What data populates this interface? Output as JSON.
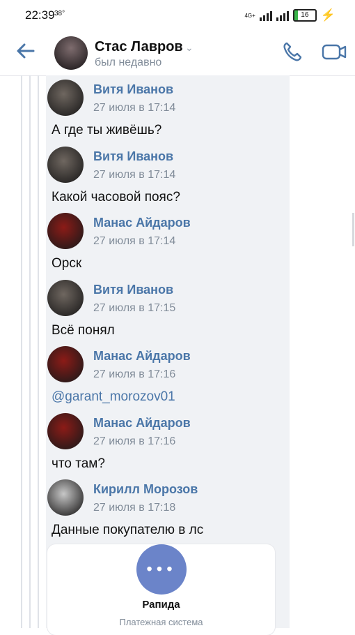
{
  "status_bar": {
    "time": "22:39",
    "temp": "38°",
    "network": "4G+",
    "battery": "16",
    "battery_level": 0.16
  },
  "header": {
    "name": "Стас Лавров",
    "status": "был недавно"
  },
  "messages": [
    {
      "author": "Витя Иванов",
      "time": "27 июля в 17:14",
      "text": "А где ты живёшь?",
      "avatar_color": "#6f6760"
    },
    {
      "author": "Витя Иванов",
      "time": "27 июля в 17:14",
      "text": "Какой часовой пояс?",
      "avatar_color": "#6f6760"
    },
    {
      "author": "Манас Айдаров",
      "time": "27 июля в 17:14",
      "text": "Орск",
      "avatar_color": "#8c1b17"
    },
    {
      "author": "Витя Иванов",
      "time": "27 июля в 17:15",
      "text": "Всё понял",
      "avatar_color": "#6f6760"
    },
    {
      "author": "Манас Айдаров",
      "time": "27 июля в 17:16",
      "text": "@garant_morozov01",
      "avatar_color": "#8c1b17"
    },
    {
      "author": "Манас Айдаров",
      "time": "27 июля в 17:16",
      "text": "что там?",
      "avatar_color": "#8c1b17"
    },
    {
      "author": "Кирилл Морозов",
      "time": "27 июля в 17:18",
      "text": "Данные покупателю в лс",
      "avatar_color": "#c7c7c7"
    }
  ],
  "card": {
    "dots": "•••",
    "title": "Рапида",
    "subtitle": "Платежная система"
  },
  "colors": {
    "accent": "#4a76a8",
    "thread_bg": "#f0f2f5"
  }
}
